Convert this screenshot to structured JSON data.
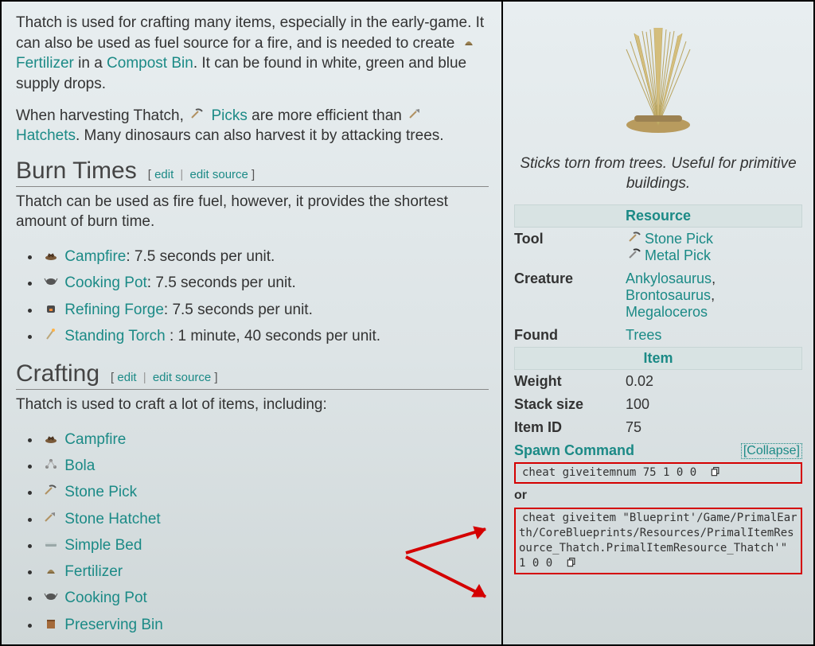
{
  "article": {
    "intro": {
      "p1_a": "Thatch is used for crafting many items, especially in the early-game. It can also be used as fuel source for a fire, and is needed to create ",
      "link1": "Fertilizer",
      "p1_b": " in a ",
      "link2": "Compost Bin",
      "p1_c": ". It can be found in white, green and blue supply drops.",
      "p2_a": "When harvesting Thatch, ",
      "link3": "Picks",
      "p2_b": " are more efficient than ",
      "link4": "Hatchets",
      "p2_c": ". Many dinosaurs can also harvest it by attacking trees."
    },
    "burn": {
      "heading": "Burn Times",
      "edit": "edit",
      "edit_source": "edit source",
      "desc": "Thatch can be used as fire fuel, however, it provides the shortest amount of burn time.",
      "items": [
        {
          "name": "Campfire",
          "icon": "campfire",
          "suffix": ": 7.5 seconds per unit."
        },
        {
          "name": "Cooking Pot",
          "icon": "cookingpot",
          "suffix": ": 7.5 seconds per unit."
        },
        {
          "name": "Refining Forge",
          "icon": "forge",
          "suffix": ": 7.5 seconds per unit."
        },
        {
          "name": "Standing Torch",
          "icon": "torch",
          "suffix": " : 1 minute, 40 seconds per unit."
        }
      ]
    },
    "craft": {
      "heading": "Crafting",
      "edit": "edit",
      "edit_source": "edit source",
      "desc": "Thatch is used to craft a lot of items, including:",
      "items": [
        {
          "name": "Campfire",
          "icon": "campfire"
        },
        {
          "name": "Bola",
          "icon": "bola"
        },
        {
          "name": "Stone Pick",
          "icon": "pick"
        },
        {
          "name": "Stone Hatchet",
          "icon": "hatchet"
        },
        {
          "name": "Simple Bed",
          "icon": "bed"
        },
        {
          "name": "Fertilizer",
          "icon": "fertilizer"
        },
        {
          "name": "Cooking Pot",
          "icon": "cookingpot"
        },
        {
          "name": "Preserving Bin",
          "icon": "bin"
        }
      ]
    }
  },
  "infobox": {
    "flavor": "Sticks torn from trees. Useful for primitive buildings.",
    "resource_label": "Resource",
    "tool": {
      "label": "Tool",
      "v1": "Stone Pick",
      "v2": "Metal Pick"
    },
    "creature": {
      "label": "Creature",
      "v1": "Ankylosaurus",
      "v2": "Brontosaurus",
      "v3": "Megaloceros"
    },
    "found": {
      "label": "Found",
      "v": "Trees"
    },
    "item_label": "Item",
    "weight": {
      "label": "Weight",
      "v": "0.02"
    },
    "stack": {
      "label": "Stack size",
      "v": "100"
    },
    "id": {
      "label": "Item ID",
      "v": "75"
    },
    "spawn": {
      "label": "Spawn Command",
      "collapse": "Collapse",
      "cmd1": "cheat giveitemnum 75 1 0 0",
      "or": "or",
      "cmd2": "cheat giveitem \"Blueprint'/Game/PrimalEarth/CoreBlueprints/Resources/PrimalItemResource_Thatch.PrimalItemResource_Thatch'\" 1 0 0"
    }
  }
}
